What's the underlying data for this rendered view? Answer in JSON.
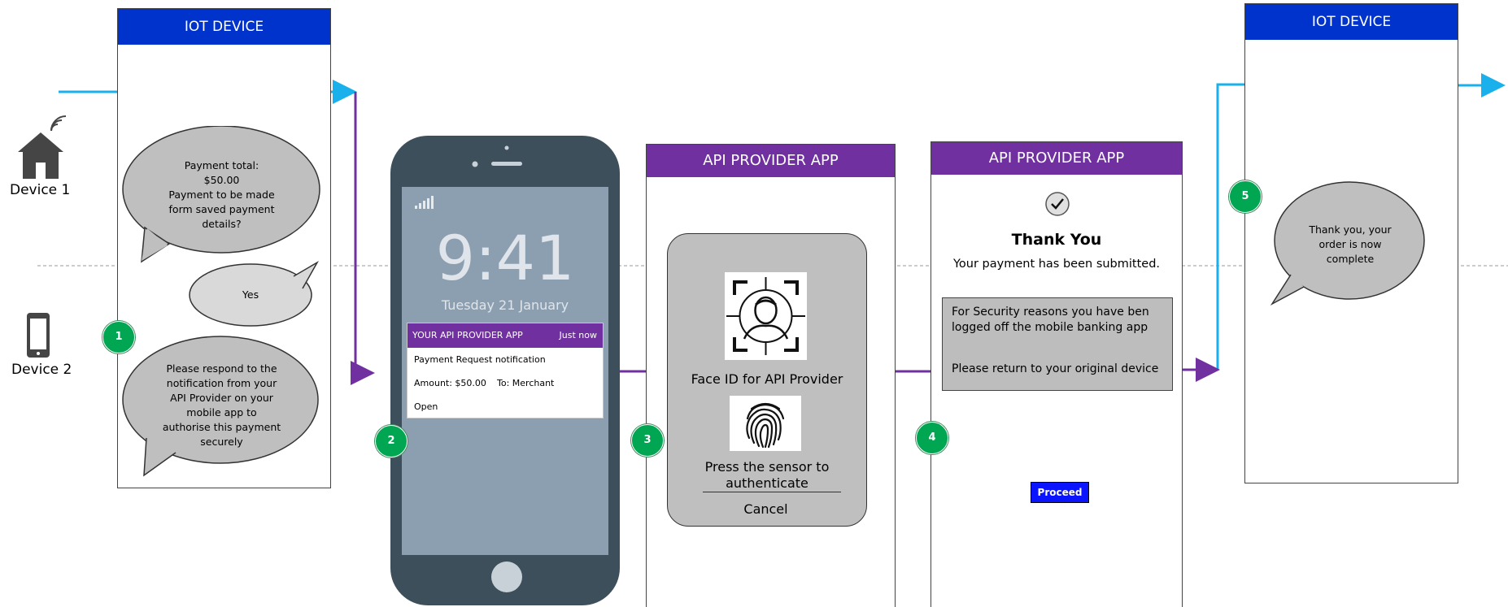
{
  "colors": {
    "flow_blue": "#1ab0ec",
    "flow_purple": "#7030a0",
    "header_blue": "#0033cc",
    "header_purple": "#7030a0",
    "badge_green": "#00a651",
    "bubble_gray": "#bfbfbf",
    "phone_body": "#3e4f5c",
    "phone_screen": "#8c9fb1",
    "button_blue": "#0a14ff"
  },
  "lanes": {
    "device1": {
      "label": "Device 1",
      "icon": "smart-home-icon"
    },
    "device2": {
      "label": "Device 2",
      "icon": "smartphone-icon"
    }
  },
  "iot_panel_1": {
    "header": "IOT DEVICE",
    "icon": "smart-home-icon",
    "bubble_payment": [
      "Payment total:",
      "$50.00",
      "Payment to be made",
      "form saved payment",
      "details?"
    ],
    "bubble_yes": "Yes",
    "bubble_respond": [
      "Please respond to the",
      "notification from your",
      "API Provider on your",
      "mobile app to",
      "authorise this payment",
      "securely"
    ]
  },
  "phone": {
    "signal_icon": "signal-bars-icon",
    "time": "9:41",
    "date": "Tuesday 21 January",
    "notification": {
      "app": "YOUR API PROVIDER APP",
      "when": "Just now",
      "title": "Payment Request notification",
      "amount": "Amount: $50.00",
      "to": "To: Merchant",
      "action": "Open"
    }
  },
  "auth_panel": {
    "header": "API PROVIDER APP",
    "face_icon": "face-id-icon",
    "face_label": "Face ID for API Provider",
    "fingerprint_icon": "fingerprint-icon",
    "sensor_label": [
      "Press the sensor to",
      "authenticate"
    ],
    "cancel": "Cancel"
  },
  "confirm_panel": {
    "header": "API PROVIDER APP",
    "check_icon": "checkmark-icon",
    "title": "Thank You",
    "subtitle": "Your payment has been submitted.",
    "security_lines": [
      "For Security reasons you have ben",
      "logged off the mobile banking app"
    ],
    "return_line": "Please return to your original device",
    "proceed": "Proceed"
  },
  "iot_panel_2": {
    "header": "IOT DEVICE",
    "icon": "smart-home-icon",
    "bubble_thanks": [
      "Thank you, your",
      "order is now",
      "complete"
    ]
  },
  "steps": [
    "1",
    "2",
    "3",
    "4",
    "5"
  ]
}
